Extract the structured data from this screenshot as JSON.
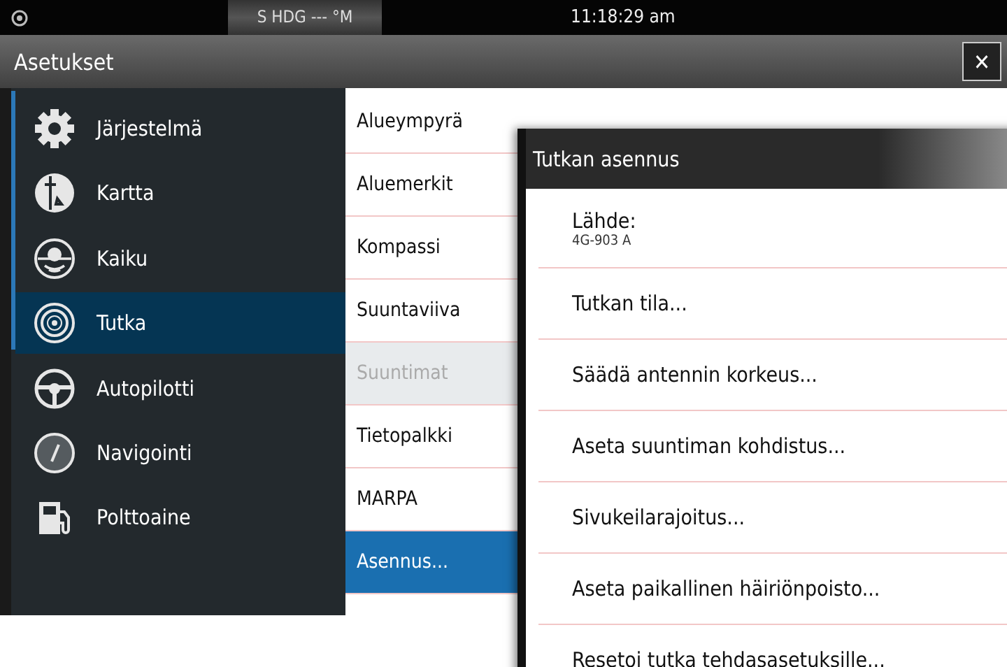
{
  "status_bar": {
    "heading": "S HDG --- °M",
    "time": "11:18:29 am"
  },
  "window": {
    "title": "Asetukset",
    "close": "✕"
  },
  "sidebar": {
    "items": [
      {
        "label": "Järjestelmä",
        "kind": "gear",
        "selected": false
      },
      {
        "label": "Kartta",
        "kind": "chart",
        "selected": false
      },
      {
        "label": "Kaiku",
        "kind": "sonar",
        "selected": false
      },
      {
        "label": "Tutka",
        "kind": "radar",
        "selected": true
      },
      {
        "label": "Autopilotti",
        "kind": "wheel",
        "selected": false
      },
      {
        "label": "Navigointi",
        "kind": "compass",
        "selected": false
      },
      {
        "label": "Polttoaine",
        "kind": "fuel",
        "selected": false
      }
    ]
  },
  "list": {
    "items": [
      {
        "label": "Alueympyrä",
        "selected": false,
        "disabled": false
      },
      {
        "label": "Aluemerkit",
        "selected": false,
        "disabled": false
      },
      {
        "label": "Kompassi",
        "selected": false,
        "disabled": false
      },
      {
        "label": "Suuntaviiva",
        "selected": false,
        "disabled": false
      },
      {
        "label": "Suuntimat",
        "selected": false,
        "disabled": true
      },
      {
        "label": "Tietopalkki",
        "selected": false,
        "disabled": false
      },
      {
        "label": "MARPA",
        "selected": false,
        "disabled": false
      },
      {
        "label": "Asennus...",
        "selected": true,
        "disabled": false
      }
    ]
  },
  "dialog": {
    "title": "Tutkan asennus",
    "items": [
      {
        "label": "Lähde:",
        "value": "4G-903 A"
      },
      {
        "label": "Tutkan tila..."
      },
      {
        "label": "Säädä antennin korkeus..."
      },
      {
        "label": "Aseta suuntiman kohdistus..."
      },
      {
        "label": "Sivukeilarajoitus..."
      },
      {
        "label": "Aseta paikallinen häiriönpoisto..."
      },
      {
        "label": "Resetoi tutka tehdasasetuksille..."
      }
    ]
  }
}
